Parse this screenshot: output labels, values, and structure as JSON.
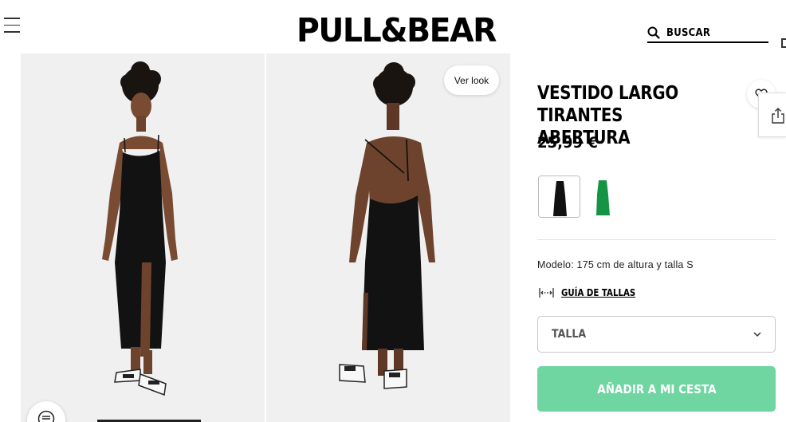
{
  "header": {
    "logo": "PULL&BEAR",
    "search_label": "BUSCAR"
  },
  "gallery": {
    "ver_look_label": "Ver look"
  },
  "product": {
    "title": "VESTIDO LARGO TIRANTES ABERTURA",
    "price": "25,99 €",
    "colors": [
      {
        "name": "negro",
        "hex": "#111111"
      },
      {
        "name": "verde",
        "hex": "#169446"
      }
    ],
    "model_info": "Modelo: 175 cm de altura y talla S",
    "size_guide_label": "GUÍA DE TALLAS",
    "size_select_label": "TALLA",
    "add_to_cart_label": "AÑADIR A MI CESTA"
  },
  "colors": {
    "accent_button": "#6fd6a2",
    "photo_background": "#f0f0f0"
  }
}
